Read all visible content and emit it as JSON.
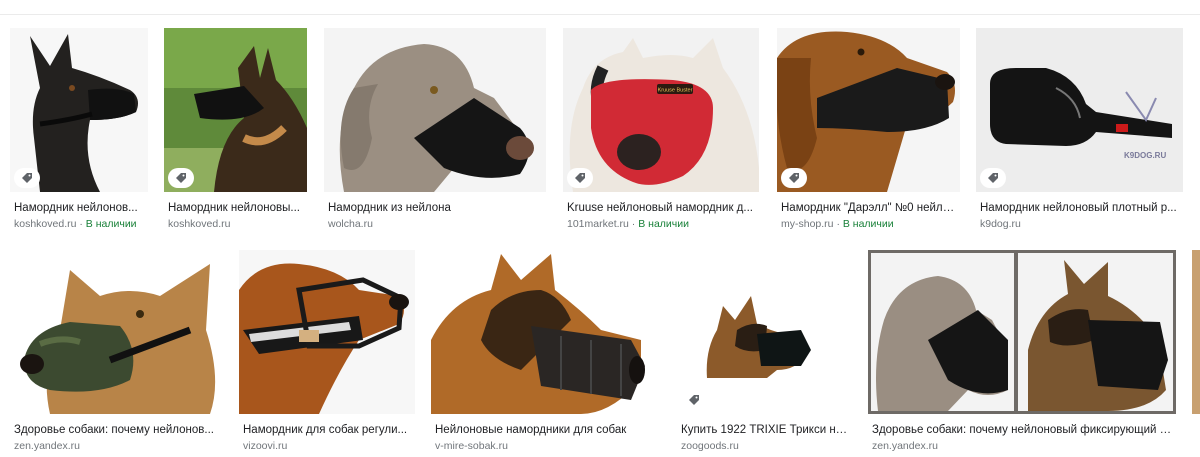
{
  "results": [
    {
      "title": "Намордник нейлонов...",
      "source": "koshkoved.ru",
      "availability": "В наличии",
      "tagged": true
    },
    {
      "title": "Намордник нейлоновы...",
      "source": "koshkoved.ru",
      "availability": "",
      "tagged": true
    },
    {
      "title": "Намордник из нейлона",
      "source": "wolcha.ru",
      "availability": "",
      "tagged": false
    },
    {
      "title": "Kruuse нейлоновый намордник д...",
      "source": "101market.ru",
      "availability": "В наличии",
      "tagged": true
    },
    {
      "title": "Намордник \"Дарэлл\" №0 нейло...",
      "source": "my-shop.ru",
      "availability": "В наличии",
      "tagged": true
    },
    {
      "title": "Намордник нейлоновый плотный р...",
      "source": "k9dog.ru",
      "availability": "",
      "tagged": true
    },
    {
      "title": "Здоровье собаки: почему нейлонов...",
      "source": "zen.yandex.ru",
      "availability": "",
      "tagged": false
    },
    {
      "title": "Намордник для собак регули...",
      "source": "vizoovi.ru",
      "availability": "",
      "tagged": false
    },
    {
      "title": "Нейлоновые намордники для собак",
      "source": "v-mire-sobak.ru",
      "availability": "",
      "tagged": false
    },
    {
      "title": "Купить 1922 TRIXIE Трикси на...",
      "source": "zoogoods.ru",
      "availability": "",
      "tagged": true
    },
    {
      "title": "Здоровье собаки: почему нейлоновый фиксирующий н...",
      "source": "zen.yandex.ru",
      "availability": "",
      "tagged": false
    }
  ],
  "separator": "·",
  "image_text": {
    "label_on_muzzle": "Kruuse Buster",
    "watermark": "K9DOG.RU"
  },
  "icons": {
    "tag": "shopping-tag-icon"
  },
  "colors": {
    "title": "#202124",
    "meta": "#70757a",
    "availability": "#188038"
  }
}
